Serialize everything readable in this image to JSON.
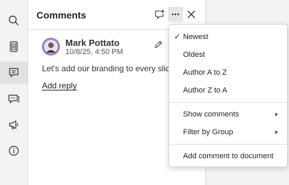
{
  "rail": {
    "items": [
      {
        "icon": "search-icon"
      },
      {
        "icon": "slides-icon"
      },
      {
        "icon": "comments-icon"
      },
      {
        "icon": "message-dots-icon"
      },
      {
        "icon": "megaphone-icon"
      },
      {
        "icon": "info-icon"
      }
    ]
  },
  "panel": {
    "title": "Comments",
    "new_comment_icon": "new-comment-icon",
    "more_icon": "more-options-icon",
    "close_icon": "close-icon"
  },
  "comment": {
    "author": "Mark Pottato",
    "timestamp": "10/8/25, 4:50 PM",
    "text": "Let's add our branding to every slide",
    "reply_label": "Add reply"
  },
  "menu": {
    "sort": {
      "newest": "Newest",
      "oldest": "Oldest",
      "author_az": "Author A to Z",
      "author_za": "Author Z to A",
      "checkmark": "✓"
    },
    "show_comments": "Show comments",
    "filter_by_group": "Filter by Group",
    "add_comment_to_document": "Add comment to document"
  },
  "colors": {
    "accent_avatar": "#9b7fc4",
    "panel_bg": "#ffffff",
    "rail_bg": "#f3f3f3"
  }
}
